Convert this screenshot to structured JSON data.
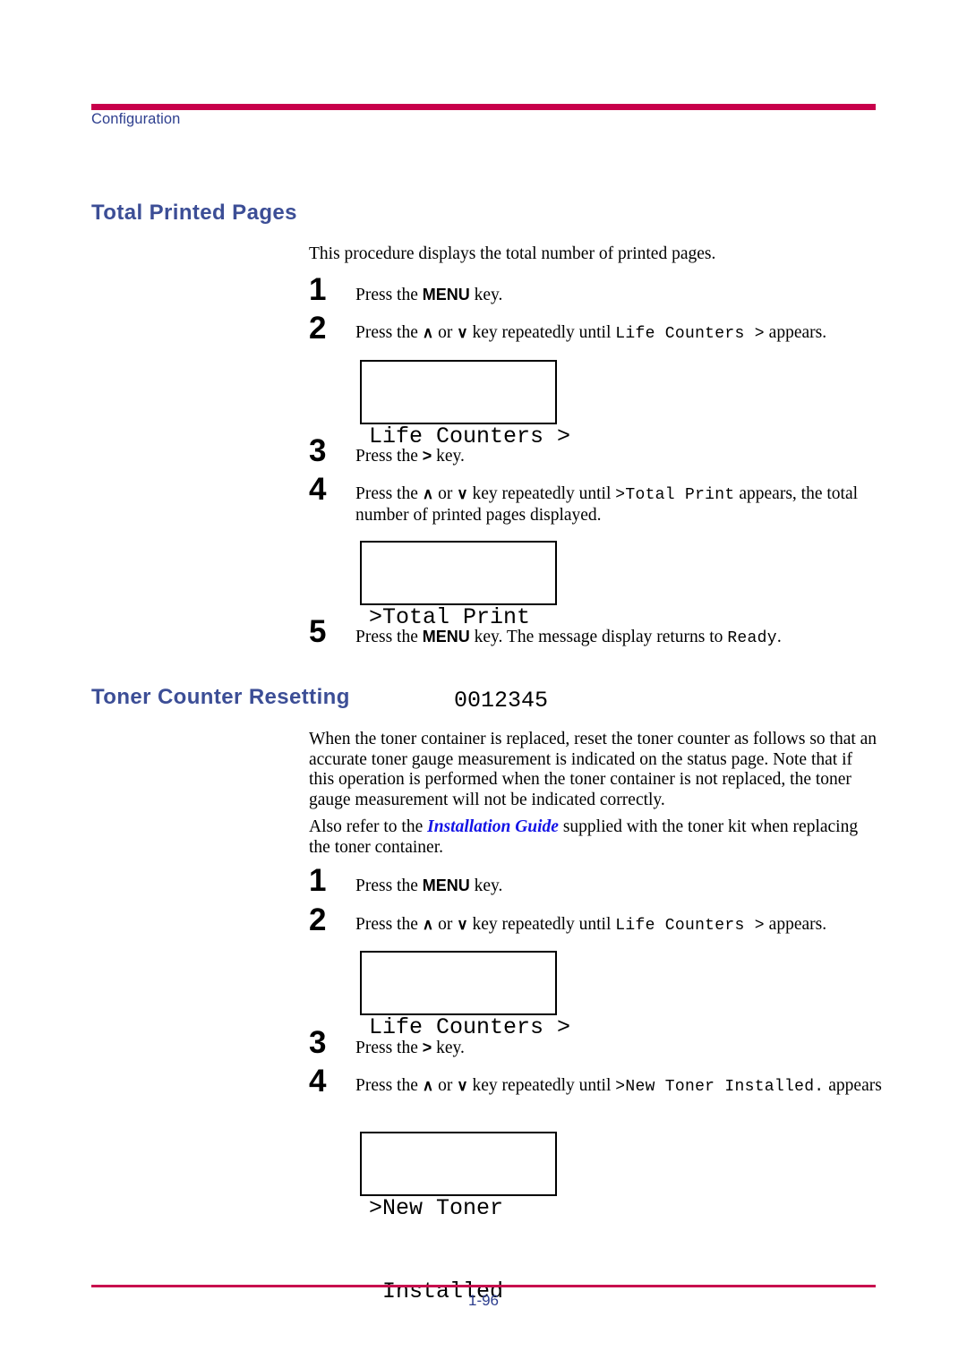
{
  "header": {
    "label": "Configuration",
    "rule_color": "#c8004b"
  },
  "footer": {
    "page_number": "1-96",
    "rule_color": "#c8104e"
  },
  "colors": {
    "heading_blue": "#3c4e96",
    "header_label_blue": "#2e3f8f",
    "link_blue": "#1414e6",
    "rule_crimson": "#c8004b"
  },
  "sections": [
    {
      "heading": "Total Printed Pages",
      "intro": "This procedure displays the total number of printed pages.",
      "steps": [
        {
          "number": "1",
          "prefix": "Press the ",
          "key": "MENU",
          "suffix": " key."
        },
        {
          "number": "2",
          "prefix": "Press the ",
          "up": "∧",
          "or": " or ",
          "down": "∨",
          "mid": " key repeatedly until ",
          "mono": "Life Counters >",
          "suffix": " appears."
        },
        {
          "number": "3",
          "prefix": "Press the ",
          "key": ">",
          "suffix": " key."
        },
        {
          "number": "4",
          "prefix": "Press the ",
          "up": "∧",
          "or": " or ",
          "down": "∨",
          "mid": " key repeatedly until ",
          "mono": ">Total Print",
          "suffix": " appears, the total number of printed pages displayed."
        },
        {
          "number": "5",
          "prefix": "Press the ",
          "key": "MENU",
          "mid": " key. The message display returns to ",
          "mono": "Ready",
          "suffix": "."
        }
      ],
      "displays": [
        {
          "line1": "Life Counters >",
          "line2": ""
        },
        {
          "line1": ">Total Print",
          "line2": "0012345"
        }
      ]
    },
    {
      "heading": "Toner Counter Resetting",
      "paragraph": "When the toner container is replaced, reset the toner counter as follows so that an accurate toner gauge measurement is indicated on the status page. Note that if this operation is performed when the toner container is not replaced, the toner gauge measurement will not be indicated correctly.",
      "note_prefix": "Also refer to the ",
      "note_link": "Installation Guide",
      "note_suffix": " supplied with the toner kit when replacing the toner container.",
      "steps": [
        {
          "number": "1",
          "prefix": "Press the ",
          "key": "MENU",
          "suffix": " key."
        },
        {
          "number": "2",
          "prefix": "Press the ",
          "up": "∧",
          "or": " or ",
          "down": "∨",
          "mid": " key repeatedly until ",
          "mono": "Life Counters >",
          "suffix": " appears."
        },
        {
          "number": "3",
          "prefix": "Press the ",
          "key": ">",
          "suffix": " key."
        },
        {
          "number": "4",
          "prefix": "Press the ",
          "up": "∧",
          "or": " or ",
          "down": "∨",
          "mid": " key repeatedly until ",
          "mono": ">New Toner Installed.",
          "suffix": " appears"
        }
      ],
      "displays": [
        {
          "line1": "Life Counters >",
          "line2": ""
        },
        {
          "line1": ">New Toner",
          "line2": " Installed"
        }
      ]
    }
  ]
}
